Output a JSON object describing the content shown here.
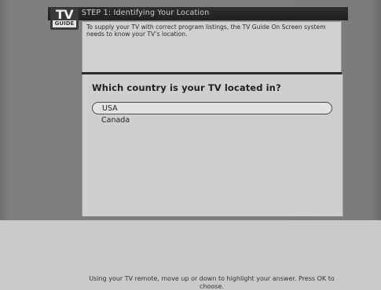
{
  "header": {
    "logo_tv": "TV",
    "logo_guide": "GUIDE",
    "title": "STEP 1: Identifying Your Location"
  },
  "info": {
    "text": "To supply your TV with correct program listings, the TV Guide On Screen system needs to know your TV’s location."
  },
  "question": {
    "text": "Which country is your TV located in?"
  },
  "options": [
    {
      "label": "USA",
      "selected": true
    },
    {
      "label": "Canada",
      "selected": false
    }
  ],
  "footer": {
    "text": "Using your TV remote, move up or down to highlight your answer. Press OK to choose."
  }
}
